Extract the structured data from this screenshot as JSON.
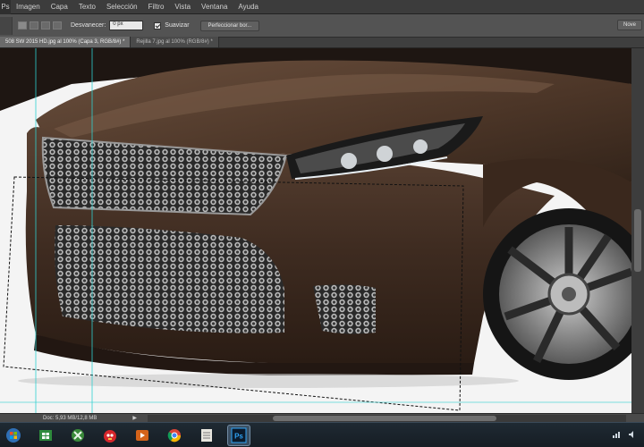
{
  "menu": {
    "corner": "Ps",
    "items": [
      "Imagen",
      "Capa",
      "Texto",
      "Selección",
      "Filtro",
      "Vista",
      "Ventana",
      "Ayuda"
    ]
  },
  "options": {
    "feather_label": "Desvanecer:",
    "feather_value": "0 px",
    "antialias_label": "Suavizar",
    "refine_button": "Perfeccionar bor...",
    "workspace_button": "Nove"
  },
  "tabs": [
    {
      "label": "508 SW 2015 HD.jpg al 100% (Capa 3, RGB/8#) *",
      "active": true
    },
    {
      "label": "Rejilla 7.jpg al 100% (RGB/8#) *",
      "active": false
    }
  ],
  "status": {
    "doc": "Doc: 5,93 MB/12,8 MB",
    "arrow": "▶"
  },
  "taskbar": {
    "icons": [
      "start-orb",
      "windows-store",
      "xbox",
      "angry-birds",
      "media-player",
      "chrome",
      "notepad",
      "photoshop"
    ]
  },
  "colors": {
    "car_body": "#4a3426",
    "accent_guides": "#2fd0d0",
    "ps_blue": "#2fa3f5"
  }
}
